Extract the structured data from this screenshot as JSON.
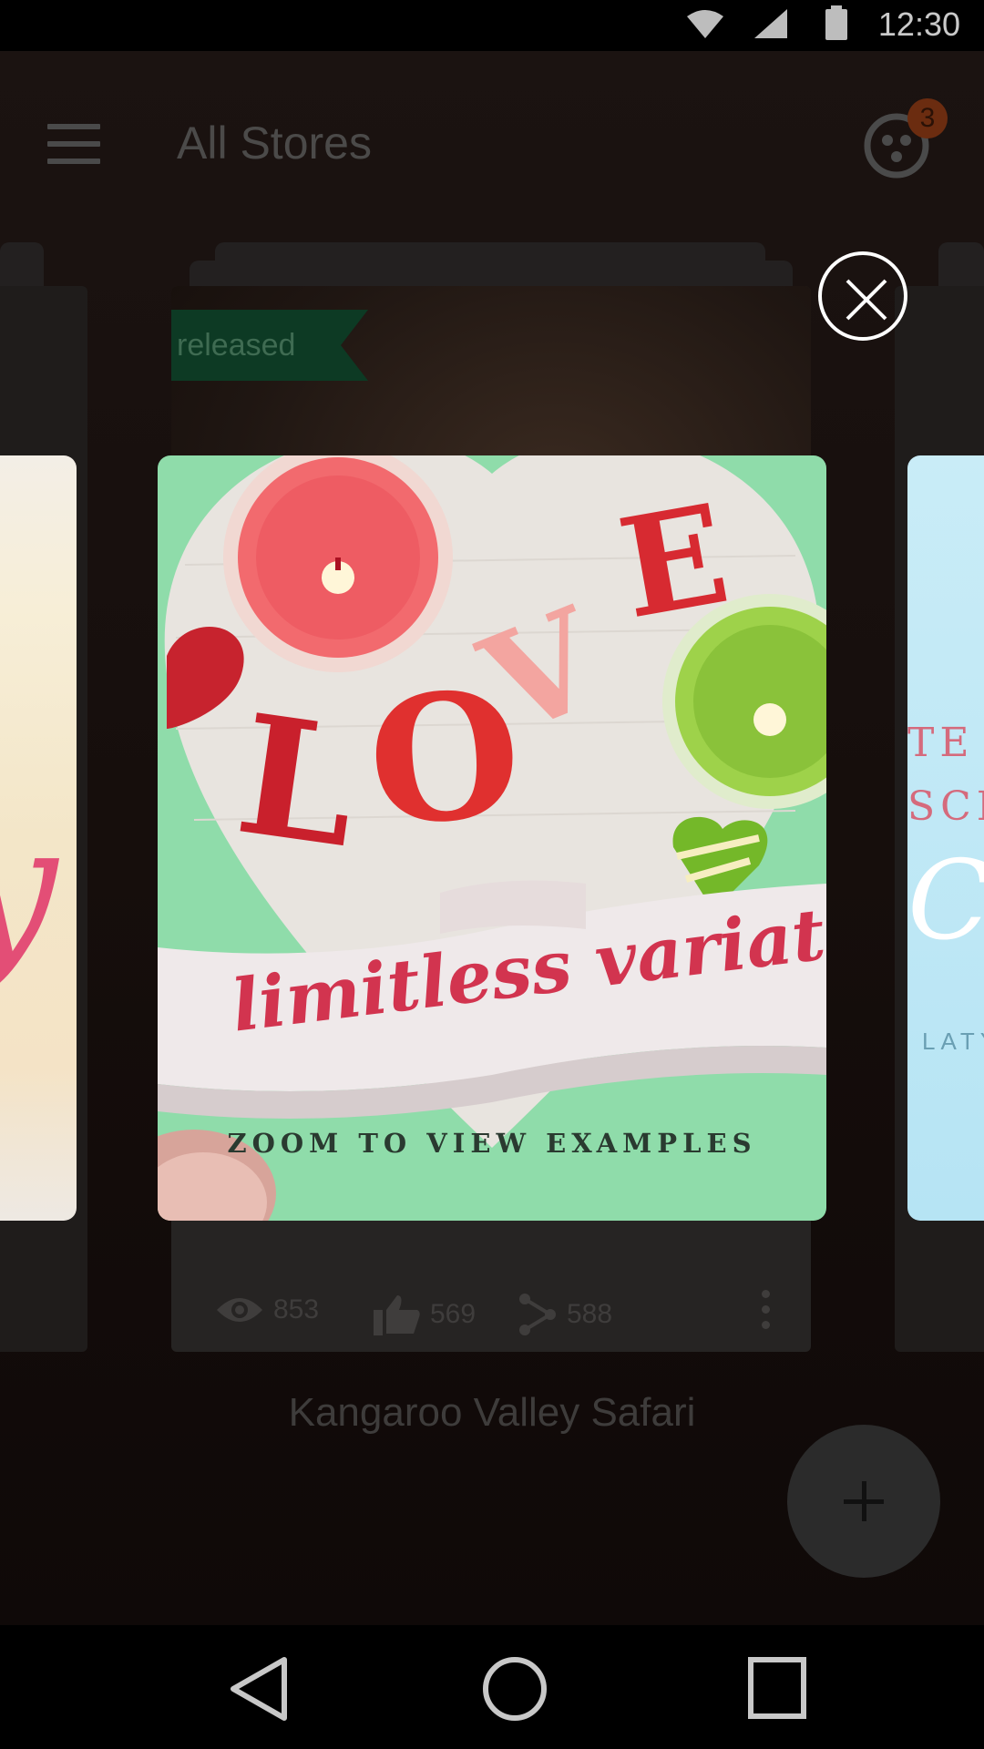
{
  "status_bar": {
    "time": "12:30",
    "icons": [
      "wifi-icon",
      "signal-icon",
      "battery-icon"
    ]
  },
  "toolbar": {
    "title": "All Stores",
    "menu_icon": "menu-icon",
    "community_icon": "community-icon",
    "notification_count": "3"
  },
  "card": {
    "ribbon_label": "released",
    "views": "853",
    "likes": "569",
    "shares": "588",
    "title": "Kangaroo Valley Safari"
  },
  "overlay": {
    "ribbon_script": "limitless variations",
    "zoom_label": "ZOOM TO VIEW EXAMPLES",
    "letters": "LOVE",
    "right_peek": {
      "line1": "TE",
      "line2": "SCE",
      "script": "C",
      "line3": "LATY"
    },
    "close_icon": "close-icon"
  },
  "fab": {
    "icon": "plus-icon"
  },
  "nav": {
    "icons": [
      "back-icon",
      "home-icon",
      "recents-icon"
    ]
  },
  "colors": {
    "ribbon_green": "#0d3a24",
    "featured_mint": "#8fdcaa",
    "script_red": "#d2344f"
  }
}
